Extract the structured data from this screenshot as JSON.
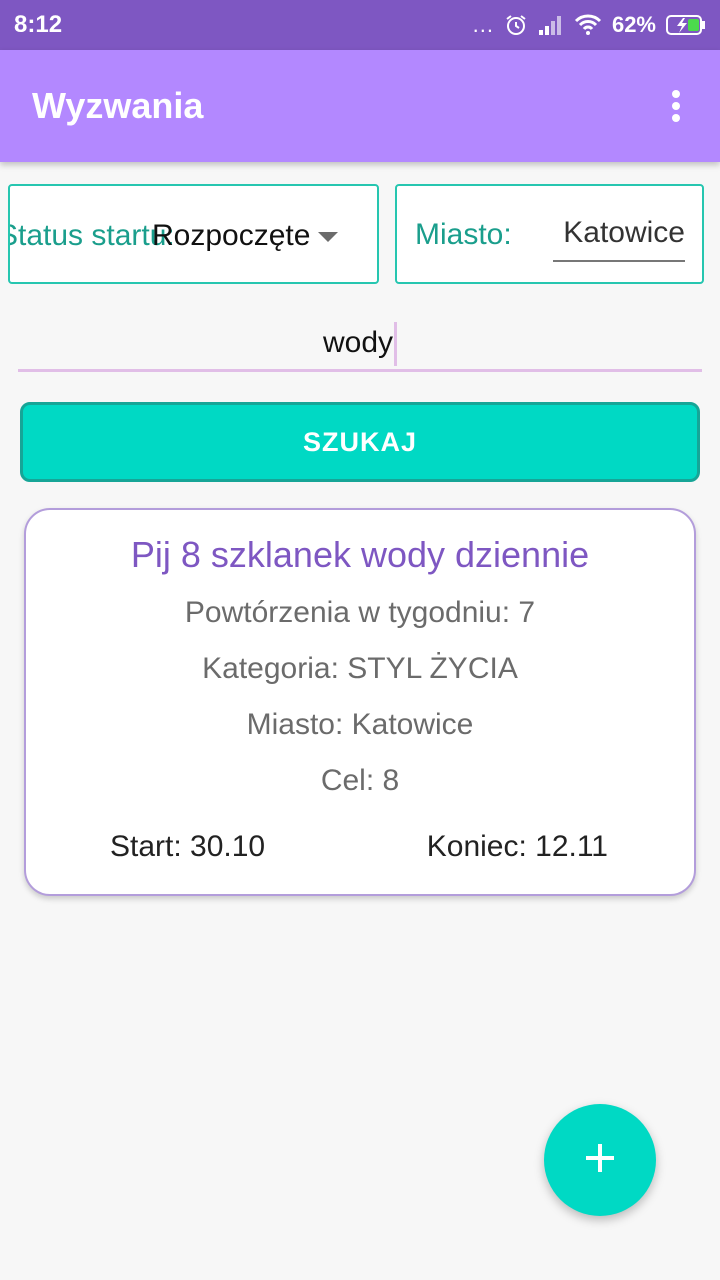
{
  "status_bar": {
    "time": "8:12",
    "dots": "...",
    "battery": "62%"
  },
  "app_bar": {
    "title": "Wyzwania",
    "menu_icon": "more-vert-icon"
  },
  "filters": {
    "status_label": "Status startu:",
    "status_value": "Rozpoczęte",
    "city_label": "Miasto:",
    "city_value": "Katowice"
  },
  "search": {
    "value": "wody",
    "button_label": "SZUKAJ"
  },
  "challenge": {
    "title": "Pij 8 szklanek wody dziennie",
    "repeats": "Powtórzenia w tygodniu: 7",
    "category": "Kategoria: STYL ŻYCIA",
    "city": "Miasto: Katowice",
    "goal": "Cel: 8",
    "start": "Start: 30.10",
    "end": "Koniec: 12.11"
  },
  "fab": {
    "icon": "plus-icon"
  },
  "colors": {
    "status_bar": "#7e57c2",
    "app_bar": "#b388ff",
    "accent": "#00d9c4",
    "title_purple": "#7e57c2"
  }
}
